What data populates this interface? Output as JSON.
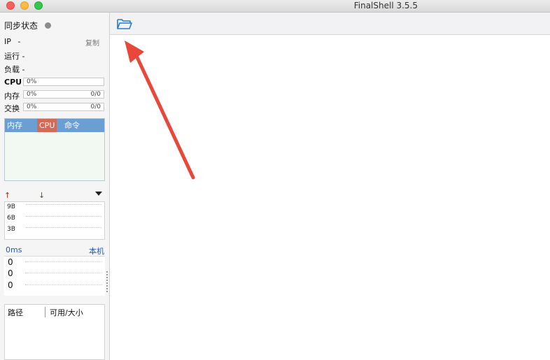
{
  "window": {
    "title": "FinalShell 3.5.5"
  },
  "sidebar": {
    "sync_label": "同步状态",
    "ip_label": "IP",
    "ip_value": "-",
    "copy_label": "复制",
    "run_label": "运行",
    "run_value": "-",
    "load_label": "负载",
    "load_value": "-",
    "cpu": {
      "label": "CPU",
      "pct": "0%"
    },
    "mem": {
      "label": "内存",
      "pct": "0%",
      "ratio": "0/0"
    },
    "swap": {
      "label": "交换",
      "pct": "0%",
      "ratio": "0/0"
    },
    "process_tabs": [
      "内存",
      "CPU",
      "命令"
    ],
    "net": {
      "up_arrow": "↑",
      "down_arrow": "↓",
      "labels": [
        "9B",
        "6B",
        "3B"
      ]
    },
    "ping": {
      "ms": "0ms",
      "host": "本机",
      "values": [
        "0",
        "0",
        "0"
      ]
    },
    "disk": {
      "col_path": "路径",
      "col_size": "可用/大小"
    }
  },
  "colors": {
    "accent_blue": "#6b9fd4",
    "cpu_tab": "#d26a56",
    "annotation_arrow": "#e8473a"
  },
  "icons": {
    "toolbar": "open-folder-icon",
    "status": "status-dot-icon"
  }
}
